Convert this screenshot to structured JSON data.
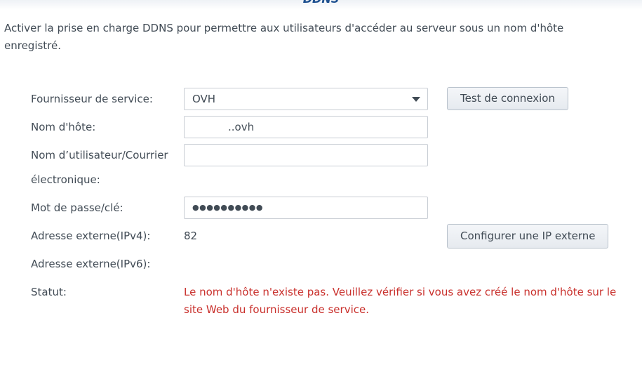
{
  "header": {
    "title": "DDNS"
  },
  "description": "Activer la prise en charge DDNS pour permettre aux utilisateurs d'accéder au serveur sous un nom d'hôte enregistré.",
  "form": {
    "provider": {
      "label": "Fournisseur de service:",
      "value": "OVH"
    },
    "hostname": {
      "label": "Nom d'hôte:",
      "value": "..ovh"
    },
    "username": {
      "label": "Nom d’utilisateur/Courrier électronique:",
      "value": ""
    },
    "password": {
      "label": "Mot de passe/clé:",
      "value": "●●●●●●●●●●"
    },
    "ipv4": {
      "label": "Adresse externe(IPv4):",
      "value": "82"
    },
    "ipv6": {
      "label": "Adresse externe(IPv6):",
      "value": ""
    },
    "status": {
      "label": "Statut:",
      "value": "Le nom d'hôte n'existe pas. Veuillez vérifier si vous avez créé le nom d'hôte sur le site Web du fournisseur de service."
    }
  },
  "buttons": {
    "test_connection": "Test de connexion",
    "configure_external_ip": "Configurer une IP externe"
  },
  "colors": {
    "status_error": "#c9302c",
    "title": "#1c4f8f"
  }
}
